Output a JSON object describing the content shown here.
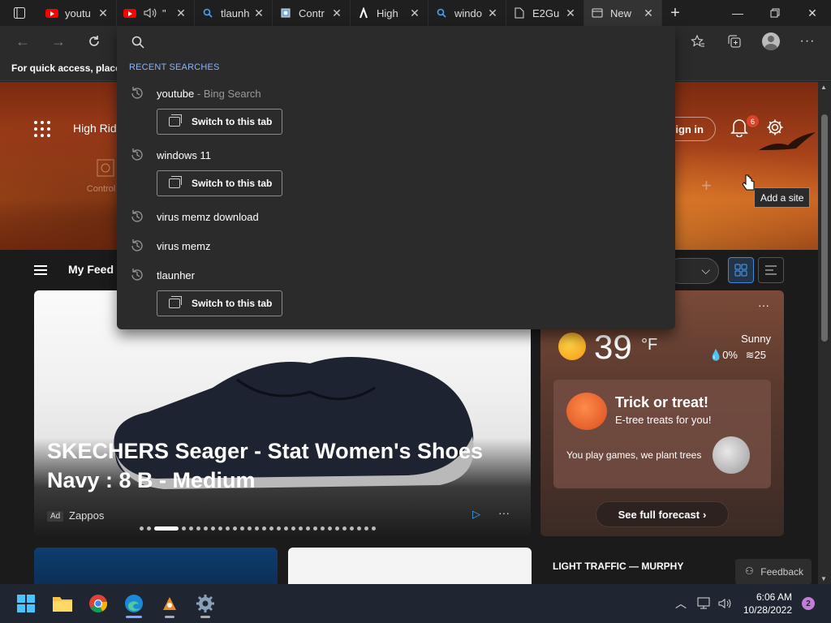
{
  "tabs": [
    {
      "title": "youtu",
      "icon": "youtube-icon"
    },
    {
      "title": "\"",
      "icon": "youtube-icon",
      "audio": true
    },
    {
      "title": "tlaunh",
      "icon": "bing-search-icon"
    },
    {
      "title": "Contr",
      "icon": "control-panel-icon"
    },
    {
      "title": "High",
      "icon": "high-ridge-icon"
    },
    {
      "title": "windo",
      "icon": "bing-search-icon"
    },
    {
      "title": "E2Gu",
      "icon": "document-icon"
    },
    {
      "title": "New",
      "icon": "new-tab-icon",
      "active": true
    }
  ],
  "favorites_bar": {
    "text": "For quick access, place y"
  },
  "suggest": {
    "header": "RECENT SEARCHES",
    "items": [
      {
        "text": "youtube",
        "sub": " - Bing Search",
        "switch": true
      },
      {
        "text": "windows 11",
        "sub": "",
        "switch": true
      },
      {
        "text": "virus memz download",
        "sub": "",
        "switch": false
      },
      {
        "text": "virus memz",
        "sub": "",
        "switch": false
      },
      {
        "text": "tlaunher",
        "sub": "",
        "switch": true
      }
    ],
    "switch_label": "Switch to this tab"
  },
  "hero": {
    "location": "High Rid",
    "tile_label": "Control C",
    "signin": "Sign in",
    "notif_count": "6",
    "tooltip": "Add a site"
  },
  "feed": {
    "title": "My Feed"
  },
  "ad": {
    "title": "SKECHERS Seager - Stat Women's Shoes Navy : 8 B - Medium",
    "tag": "Ad",
    "source": "Zappos",
    "dots_total": 30,
    "dots_active": 2
  },
  "weather": {
    "temp": "39",
    "unit": "°F",
    "condition": "Sunny",
    "precip": "0%",
    "wind": "25",
    "promo_title": "Trick or treat!",
    "promo_sub": "E-tree treats for you!",
    "promo_text": "You play games, we plant trees",
    "forecast_btn": "See full forecast"
  },
  "traffic": "LIGHT TRAFFIC — MURPHY",
  "feedback": "Feedback",
  "taskbar": {
    "time": "6:06 AM",
    "date": "10/28/2022",
    "notif": "2"
  },
  "colors": {
    "accent": "#8ab4f8",
    "badge": "#d9452b",
    "notif": "#c57bd9"
  }
}
